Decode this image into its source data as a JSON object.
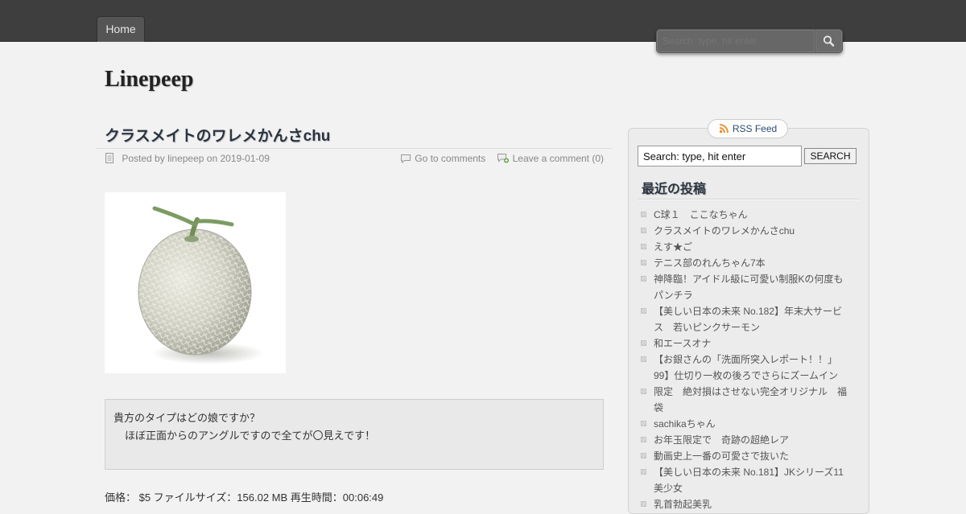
{
  "nav": {
    "home_label": "Home"
  },
  "top_search": {
    "placeholder": "Search: type, hit enter"
  },
  "site": {
    "title": "Linepeep"
  },
  "post": {
    "title": "クラスメイトのワレメかんさchu",
    "meta": {
      "posted_by": "Posted by",
      "author": "linepeep",
      "on": "on",
      "date": "2019-01-09",
      "go_to_comments": "Go to comments",
      "leave_comment": "Leave a comment (0)"
    },
    "image_icon": "cantaloupe-melon-image",
    "quote": {
      "line1": "貴方のタイプはどの娘ですか？",
      "line2": "ほぼ正面からのアングルですので全てが〇見えです！"
    },
    "price_line": "価格： $5 ファイルサイズ：156.02 MB 再生時間：00:06:49"
  },
  "sidebar": {
    "rss_label": "RSS Feed",
    "search_value": "Search: type, hit enter",
    "search_button": "SEARCH",
    "recent_title": "最近の投稿",
    "recent_posts": [
      "C球１　ここなちゃん",
      "クラスメイトのワレメかんさchu",
      "えす★ご",
      "テニス部のれんちゃん7本",
      "神降臨！アイドル級に可愛い制服Kの何度もパンチラ",
      "【美しい日本の未来 No.182】年末大サービス　若いピンクサーモン",
      "和エースオナ",
      "【お銀さんの「洗面所突入レポート！！」99】仕切り一枚の後ろでさらにズームイン",
      "限定　絶対損はさせない完全オリジナル　福袋",
      "sachikaちゃん",
      "お年玉限定で　奇跡の超絶レア",
      "動画史上一番の可愛さで抜いた",
      "【美しい日本の未来 No.181】JKシリーズ11　美少女",
      "乳首勃起美乳"
    ]
  },
  "colors": {
    "topbar": "#3e3e3e",
    "background": "#f2f2f2",
    "title_text": "#2a3440",
    "link_blue": "#2c4d75"
  }
}
